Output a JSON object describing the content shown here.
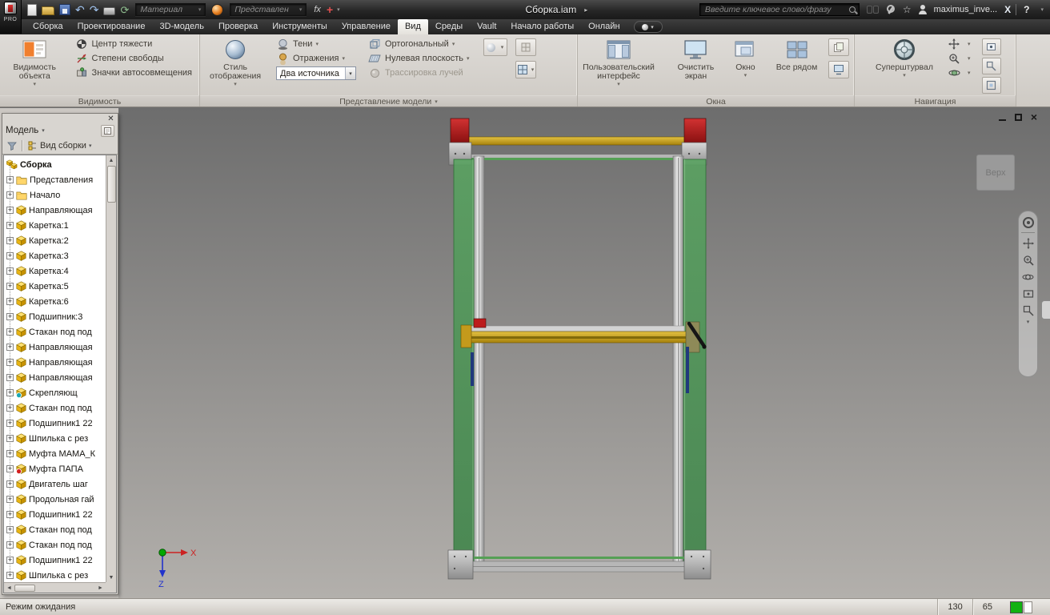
{
  "titlebar": {
    "pro_label": "PRO",
    "document_title": "Сборка.iam",
    "title_arrow": "▸",
    "material_combo": "Материал",
    "appearance_combo": "Представлен",
    "fx_label": "fx",
    "plus_label": "+",
    "search_placeholder": "Введите ключевое слово/фразу",
    "username": "maximus_inve...",
    "signout_label": "X",
    "help_label": "?",
    "quick_access": [
      {
        "name": "new-file-icon"
      },
      {
        "name": "open-icon"
      },
      {
        "name": "save-icon"
      },
      {
        "name": "undo-icon",
        "glyph": "↶"
      },
      {
        "name": "redo-icon",
        "glyph": "↷"
      },
      {
        "name": "print-icon"
      },
      {
        "name": "update-icon",
        "glyph": "⟳"
      }
    ]
  },
  "ribbon_tabs": [
    "Сборка",
    "Проектирование",
    "3D-модель",
    "Проверка",
    "Инструменты",
    "Управление",
    "Вид",
    "Среды",
    "Vault",
    "Начало работы",
    "Онлайн"
  ],
  "active_tab_index": 6,
  "ribbon": {
    "visibility": {
      "label": "Видимость",
      "object_visibility": "Видимость объекта",
      "items": [
        "Центр тяжести",
        "Степени свободы",
        "Значки автосовмещения"
      ]
    },
    "model_view": {
      "label": "Представление модели",
      "display_style": "Стиль отображения",
      "shadows": "Тени",
      "reflections": "Отражения",
      "lights_combo": "Два источника",
      "orthographic": "Ортогональный",
      "ground_plane": "Нулевая плоскость",
      "ray_tracing": "Трассировка лучей"
    },
    "windows": {
      "label": "Окна",
      "user_interface": "Пользовательский интерфейс",
      "clean_screen": "Очистить экран",
      "window": "Окно",
      "tile_all": "Все рядом"
    },
    "navigation": {
      "label": "Навигация",
      "steering_wheel": "Суперштурвал"
    }
  },
  "browser": {
    "title": "Модель",
    "view_selector": "Вид сборки",
    "items": [
      {
        "label": "Сборка",
        "type": "assembly",
        "root": true
      },
      {
        "label": "Представления",
        "type": "folder"
      },
      {
        "label": "Начало",
        "type": "folder"
      },
      {
        "label": "Направляющая",
        "type": "part"
      },
      {
        "label": "Каретка:1",
        "type": "part"
      },
      {
        "label": "Каретка:2",
        "type": "part"
      },
      {
        "label": "Каретка:3",
        "type": "part"
      },
      {
        "label": "Каретка:4",
        "type": "part"
      },
      {
        "label": "Каретка:5",
        "type": "part"
      },
      {
        "label": "Каретка:6",
        "type": "part"
      },
      {
        "label": "Подшипник:3",
        "type": "part"
      },
      {
        "label": "Стакан под под",
        "type": "part"
      },
      {
        "label": "Направляющая",
        "type": "part"
      },
      {
        "label": "Направляющая",
        "type": "part"
      },
      {
        "label": "Направляющая",
        "type": "part"
      },
      {
        "label": "Скрепляющ",
        "type": "part-teal"
      },
      {
        "label": "Стакан под под",
        "type": "part"
      },
      {
        "label": "Подшипник1 22",
        "type": "part"
      },
      {
        "label": "Шпилька с рез",
        "type": "part"
      },
      {
        "label": "Муфта МАМА_К",
        "type": "part"
      },
      {
        "label": "Муфта ПАПА",
        "type": "part-red"
      },
      {
        "label": "Двигатель шаг",
        "type": "part"
      },
      {
        "label": "Продольная гай",
        "type": "part"
      },
      {
        "label": "Подшипник1 22",
        "type": "part"
      },
      {
        "label": "Стакан под под",
        "type": "part"
      },
      {
        "label": "Стакан под под",
        "type": "part"
      },
      {
        "label": "Подшипник1 22",
        "type": "part"
      },
      {
        "label": "Шпилька с рез",
        "type": "part"
      }
    ]
  },
  "viewport": {
    "viewcube_label": "Верх"
  },
  "statusbar": {
    "message": "Режим ожидания",
    "counter1": "130",
    "counter2": "65"
  }
}
